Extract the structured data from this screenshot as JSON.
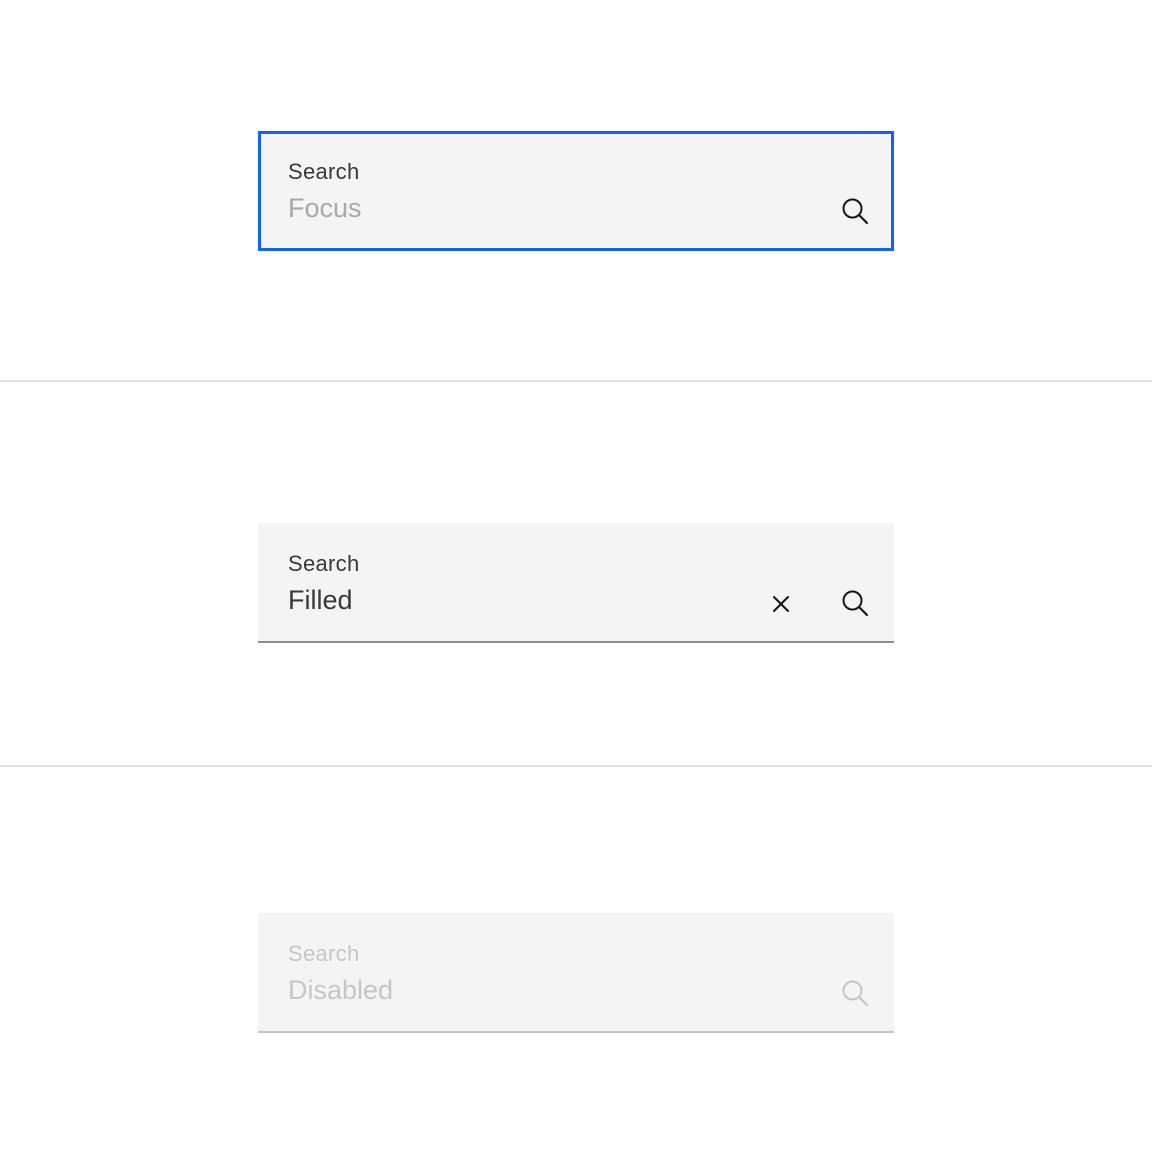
{
  "colors": {
    "focus_border": "#0f62fe",
    "field_background": "#f4f4f4",
    "text_primary": "#393939",
    "text_placeholder": "#a8a8a8",
    "text_disabled": "#c6c6c6",
    "divider": "#e0e0e0"
  },
  "fields": [
    {
      "state": "focus",
      "label": "Search",
      "placeholder": "Focus",
      "value": "",
      "icons": [
        "search-icon"
      ]
    },
    {
      "state": "filled",
      "label": "Search",
      "placeholder": "",
      "value": "Filled",
      "icons": [
        "close-icon",
        "search-icon"
      ]
    },
    {
      "state": "disabled",
      "label": "Search",
      "placeholder": "Disabled",
      "value": "",
      "icons": [
        "search-icon"
      ]
    }
  ]
}
